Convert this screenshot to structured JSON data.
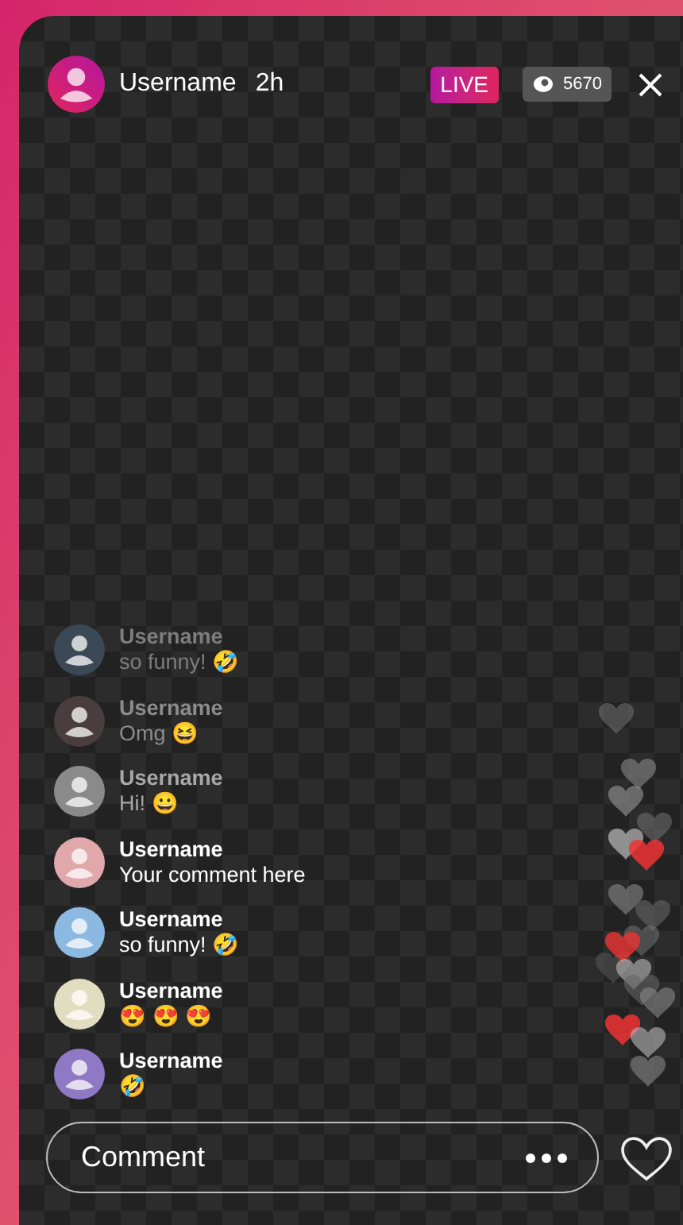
{
  "header": {
    "username": "Username",
    "time": "2h",
    "live_badge": "LIVE",
    "viewer_count": "5670"
  },
  "comments": [
    {
      "username": "Username",
      "text": "so funny! 🤣",
      "color": "#3b4856",
      "faded": true
    },
    {
      "username": "Username",
      "text": "Omg 😆",
      "color": "#4a3d3e",
      "faded": true
    },
    {
      "username": "Username",
      "text": "Hi! 😀",
      "color": "#8a8a8a",
      "faded": true
    },
    {
      "username": "Username",
      "text": "Your comment here",
      "color": "#e0a8aa",
      "faded": false
    },
    {
      "username": "Username",
      "text": "so funny! 🤣",
      "color": "#8bb9e2",
      "faded": false
    },
    {
      "username": "Username",
      "text": "😍 😍 😍",
      "color": "#e2dcc0",
      "faded": false
    },
    {
      "username": "Username",
      "text": "🤣",
      "color": "#8f78c4",
      "faded": false
    }
  ],
  "comment_field": {
    "placeholder": "Comment"
  }
}
